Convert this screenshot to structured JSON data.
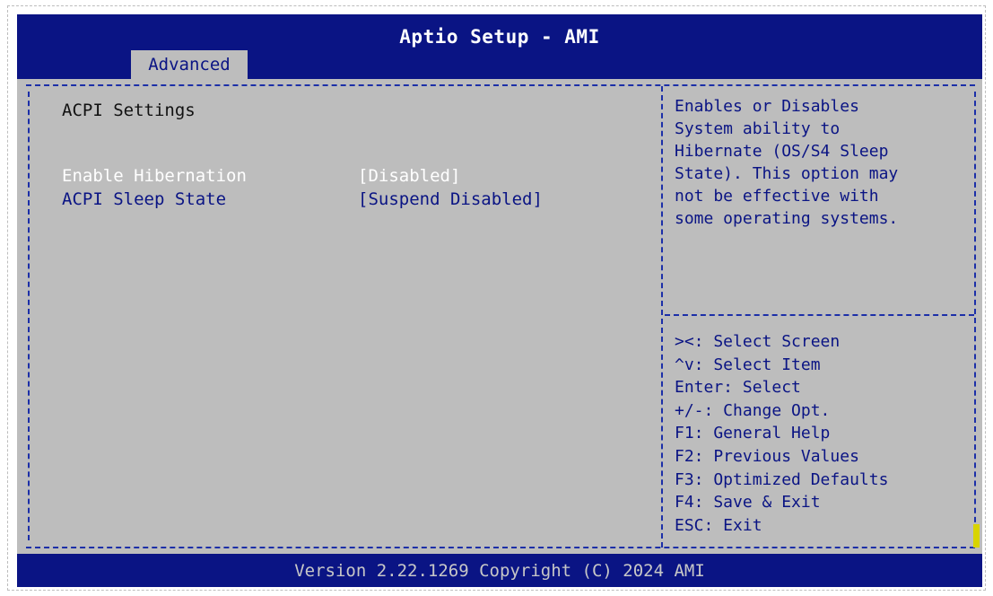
{
  "header": {
    "title": "Aptio Setup - AMI",
    "tabs": [
      {
        "label": "Advanced",
        "selected": true
      }
    ]
  },
  "main": {
    "section_title": "ACPI Settings",
    "options": [
      {
        "label": "Enable Hibernation",
        "value": "[Disabled]",
        "highlighted": true
      },
      {
        "label": "ACPI Sleep State",
        "value": "[Suspend Disabled]",
        "highlighted": false
      }
    ]
  },
  "help": {
    "text": "Enables or Disables\nSystem ability to\nHibernate (OS/S4 Sleep\nState). This option may\nnot be effective with\nsome operating systems."
  },
  "keys": [
    "><: Select Screen",
    "^v: Select Item",
    "Enter: Select",
    "+/-: Change Opt.",
    "F1: General Help",
    "F2: Previous Values",
    "F3: Optimized Defaults",
    "F4: Save & Exit",
    "ESC: Exit"
  ],
  "footer": {
    "version": "Version 2.22.1269 Copyright (C) 2024 AMI"
  },
  "colors": {
    "title_bar": "#0a1484",
    "background": "#bdbdbd",
    "highlight_text": "#ffffff",
    "text": "#0a1484",
    "scrollbar": "#d8d400"
  }
}
